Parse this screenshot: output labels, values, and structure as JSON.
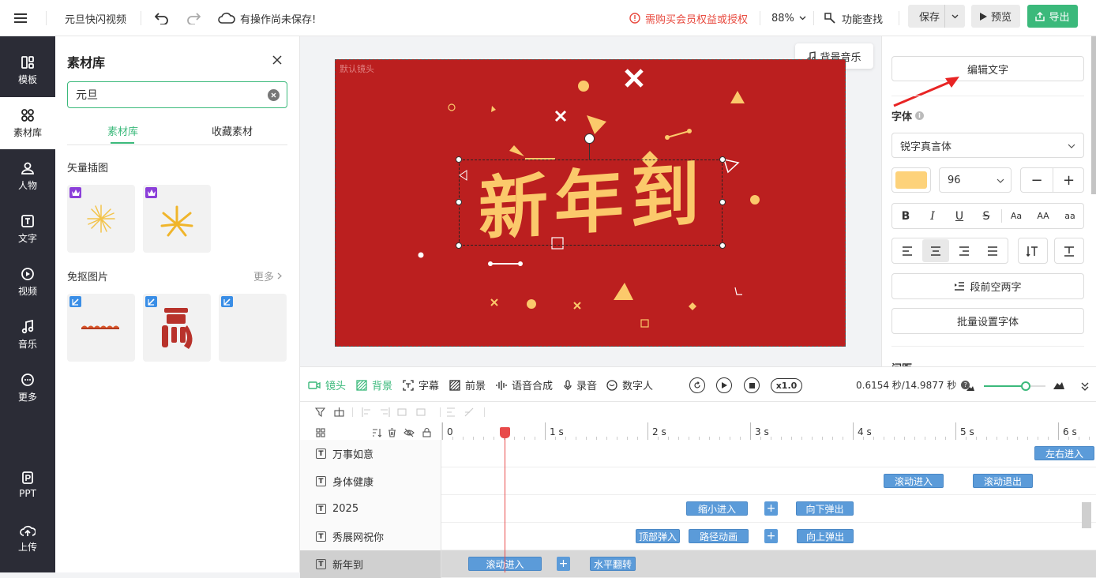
{
  "topbar": {
    "menu_icon": "menu-icon",
    "project_title": "元旦快闪视频",
    "save_status": "有操作尚未保存!",
    "warning": "需购买会员权益或授权",
    "zoom": "88%",
    "feature_search": "功能查找",
    "save": "保存",
    "preview": "预览",
    "export": "导出"
  },
  "nav": {
    "items": [
      {
        "label": "模板",
        "icon": "template-icon"
      },
      {
        "label": "素材库",
        "icon": "grid-icon"
      },
      {
        "label": "人物",
        "icon": "person-icon"
      },
      {
        "label": "文字",
        "icon": "text-icon"
      },
      {
        "label": "视频",
        "icon": "video-icon"
      },
      {
        "label": "音乐",
        "icon": "music-icon"
      },
      {
        "label": "更多",
        "icon": "more-icon"
      },
      {
        "label": "PPT",
        "icon": "ppt-icon"
      },
      {
        "label": "上传",
        "icon": "upload-icon"
      }
    ]
  },
  "assets": {
    "title": "素材库",
    "search_value": "元旦",
    "tabs": [
      "素材库",
      "收藏素材"
    ],
    "section_vector": "矢量插图",
    "section_cutout": "免抠图片",
    "more": "更多"
  },
  "canvas": {
    "camera_label": "默认镜头",
    "bg_music": "背景音乐",
    "main_text": "新年到",
    "bg_color": "#bb1f1f",
    "text_color": "#fbc96b"
  },
  "right": {
    "edit_text": "编辑文字",
    "font_section": "字体",
    "font_name": "锐字真言体",
    "font_size": "96",
    "swatch_color": "#fdd27a",
    "case_buttons": [
      "Aa",
      "AA",
      "aa"
    ],
    "indent": "段前空两字",
    "batch_font": "批量设置字体",
    "spacing": "间距"
  },
  "controls": {
    "tabs": [
      "镜头",
      "背景",
      "字幕",
      "前景",
      "语音合成",
      "录音",
      "数字人"
    ],
    "speed": "x1.0",
    "time": "0.6154 秒/14.9877 秒"
  },
  "ruler": {
    "ticks": [
      "0",
      "1 s",
      "2 s",
      "3 s",
      "4 s",
      "5 s",
      "6 s"
    ]
  },
  "tracks": [
    {
      "label": "万事如意",
      "clips": [
        {
          "text": "左右进入",
          "kind": "anim"
        }
      ]
    },
    {
      "label": "身体健康",
      "clips": [
        {
          "text": "滚动进入",
          "kind": "anim"
        },
        {
          "text": "滚动退出",
          "kind": "anim"
        }
      ]
    },
    {
      "label": "2025",
      "clips": [
        {
          "text": "缩小进入",
          "kind": "anim"
        },
        {
          "text": "+",
          "kind": "plus"
        },
        {
          "text": "向下弹出",
          "kind": "anim"
        }
      ]
    },
    {
      "label": "秀展网祝你",
      "clips": [
        {
          "text": "顶部弹入",
          "kind": "anim"
        },
        {
          "text": "路径动画",
          "kind": "anim"
        },
        {
          "text": "+",
          "kind": "plus"
        },
        {
          "text": "向上弹出",
          "kind": "anim"
        }
      ]
    },
    {
      "label": "新年到",
      "clips": [
        {
          "text": "滚动进入",
          "kind": "anim"
        },
        {
          "text": "+",
          "kind": "plus"
        },
        {
          "text": "水平翻转",
          "kind": "anim"
        }
      ]
    }
  ]
}
